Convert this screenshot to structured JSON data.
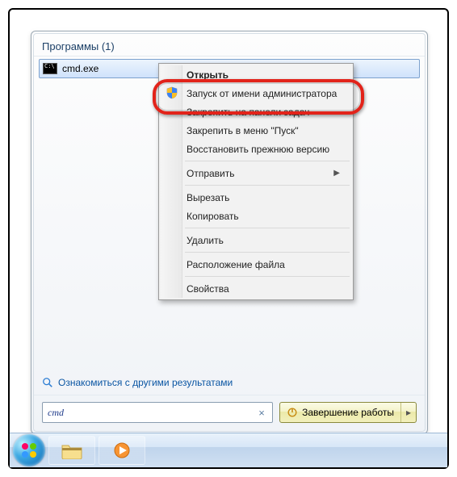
{
  "section_header": "Программы (1)",
  "result": {
    "label": "cmd.exe"
  },
  "more_results": "Ознакомиться с другими результатами",
  "search": {
    "value": "cmd",
    "placeholder": ""
  },
  "shutdown": {
    "label": "Завершение работы"
  },
  "context_menu": {
    "open": "Открыть",
    "run_as_admin": "Запуск от имени администратора",
    "pin_taskbar": "Закрепить на панели задач",
    "pin_start": "Закрепить в меню \"Пуск\"",
    "restore_prev": "Восстановить прежнюю версию",
    "send_to": "Отправить",
    "cut": "Вырезать",
    "copy": "Копировать",
    "delete": "Удалить",
    "open_location": "Расположение файла",
    "properties": "Свойства"
  }
}
